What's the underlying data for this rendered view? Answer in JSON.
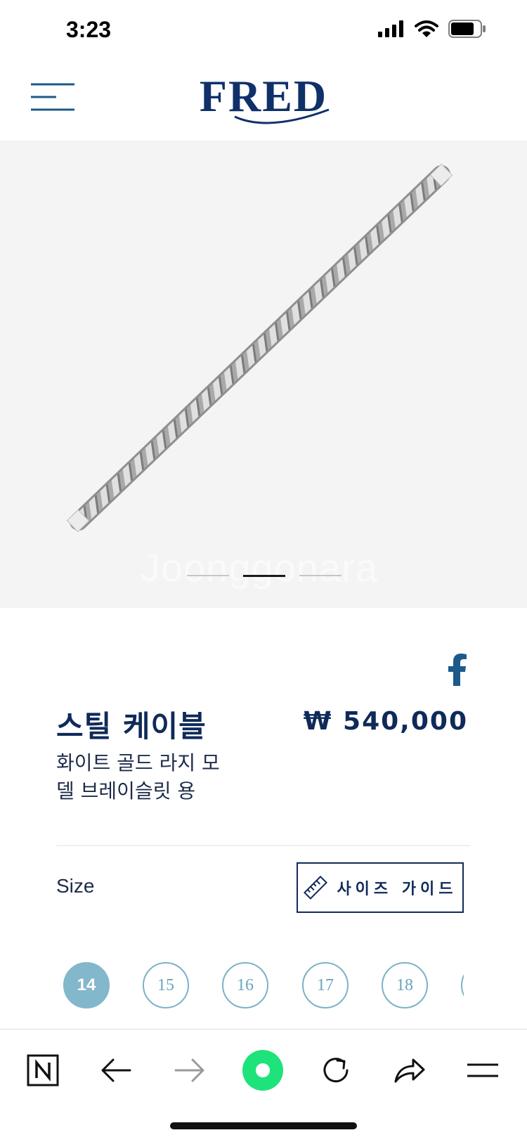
{
  "status_bar": {
    "time": "3:23"
  },
  "header": {
    "brand": "FRED"
  },
  "hero": {
    "watermark": "Joonggonara",
    "slide_count": 3,
    "active_slide": 2
  },
  "product": {
    "title": "스틸 케이블",
    "price": "₩ 540,000",
    "subtitle": "화이트 골드 라지 모델 브레이슬릿 용"
  },
  "size": {
    "label": "Size",
    "guide_label": "사이즈 가이드",
    "options": [
      "14",
      "15",
      "16",
      "17",
      "18"
    ],
    "selected": "14"
  },
  "colors": {
    "brand": "#0f2a5a",
    "accent": "#83b7cb",
    "browser_green": "#1ee37a"
  },
  "toolbar": {
    "items": [
      "naver-icon",
      "back-icon",
      "forward-icon",
      "green-dot-icon",
      "refresh-icon",
      "share-icon",
      "menu-icon"
    ]
  }
}
